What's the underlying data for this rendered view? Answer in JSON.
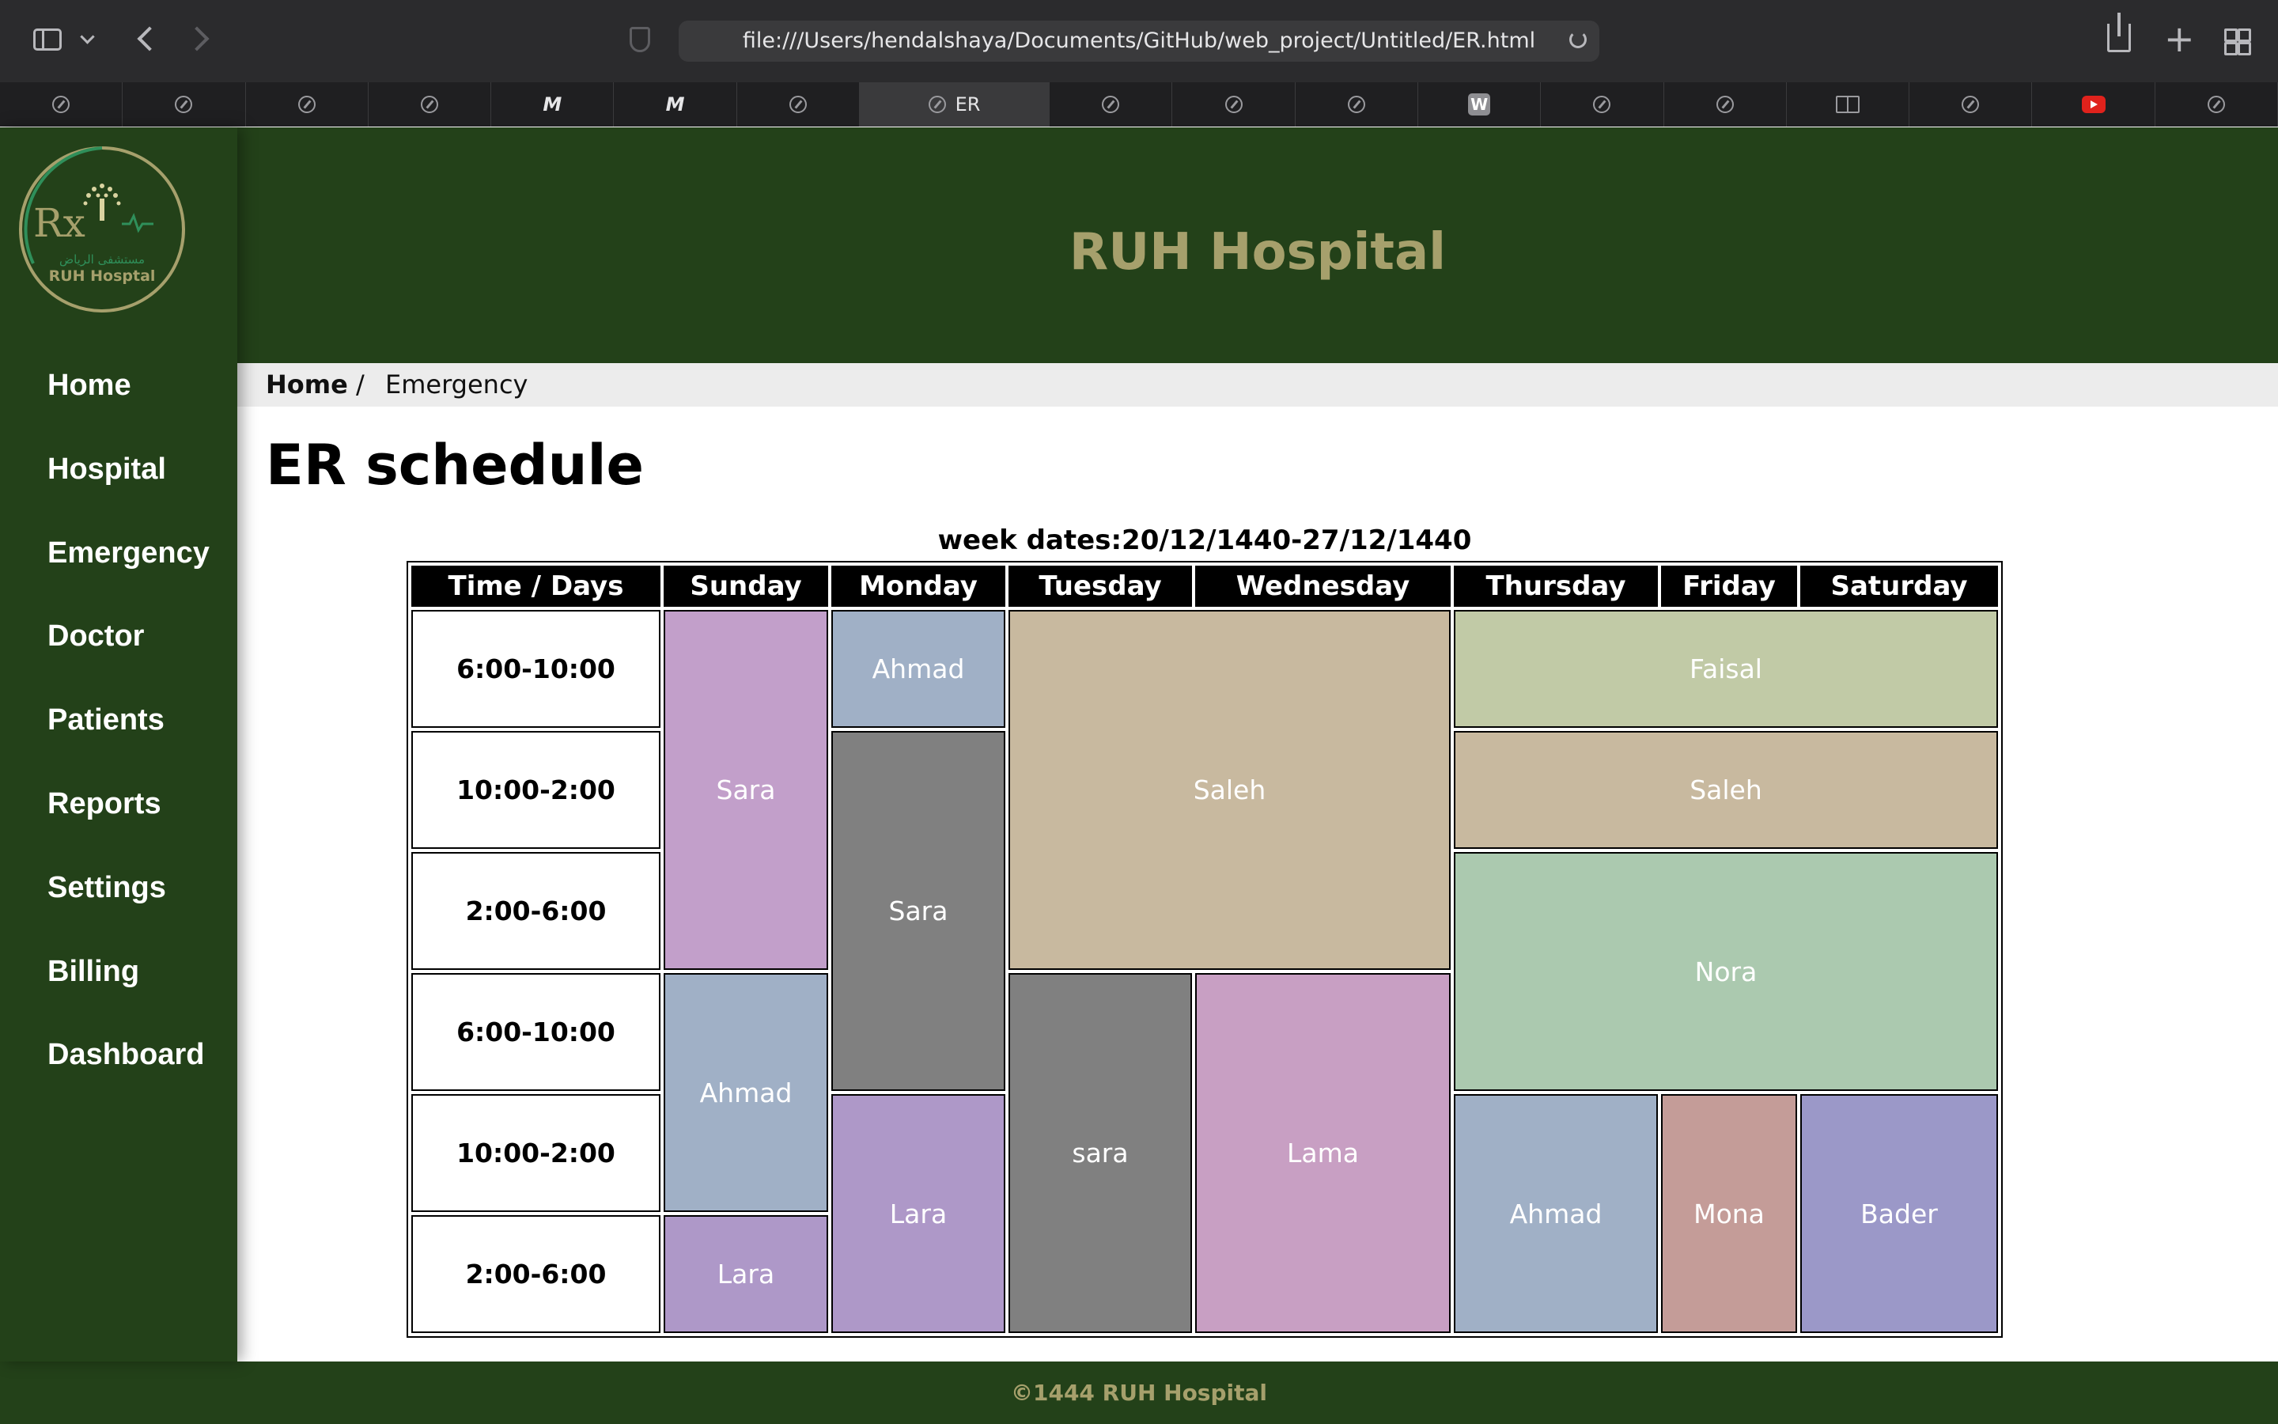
{
  "browser": {
    "url": "file:///Users/hendalshaya/Documents/GitHub/web_project/Untitled/ER.html",
    "active_tab_label": "ER",
    "tabs": [
      "compass-icon",
      "compass-icon",
      "compass-icon",
      "compass-icon",
      "medium-icon",
      "medium-icon",
      "compass-icon",
      "ER",
      "compass-icon",
      "compass-icon",
      "compass-icon",
      "w-icon",
      "compass-icon",
      "compass-icon",
      "book-icon",
      "compass-icon",
      "youtube-icon",
      "compass-icon"
    ],
    "tab_medium_glyph": "M",
    "tab_w_glyph": "W"
  },
  "logo": {
    "brand": "RUH Hosptal",
    "arabic": "مستشفى الرياض",
    "mark": "Rx",
    "colors": {
      "gold": "#a6a06c",
      "green": "#2f8f5a"
    }
  },
  "sidebar": {
    "items": [
      "Home",
      "Hospital",
      "Emergency",
      "Doctor",
      "Patients",
      "Reports",
      "Settings",
      "Billing",
      "Dashboard"
    ]
  },
  "header": {
    "title": "RUH Hospital"
  },
  "breadcrumb": {
    "home": "Home",
    "separator": "/",
    "current": "Emergency"
  },
  "page": {
    "title": "ER schedule",
    "week_dates": "week dates:20/12/1440-27/12/1440"
  },
  "schedule": {
    "headers": [
      "Time / Days",
      "Sunday",
      "Monday",
      "Tuesday",
      "Wednesday",
      "Thursday",
      "Friday",
      "Saturday"
    ],
    "times": [
      "6:00-10:00",
      "10:00-2:00",
      "2:00-6:00",
      "6:00-10:00",
      "10:00-2:00",
      "2:00-6:00"
    ],
    "slots": {
      "sun_1": {
        "name": "Sara",
        "color": "#c29fca"
      },
      "mon_1": {
        "name": "Ahmad",
        "color": "#a0b0c6"
      },
      "tue_wed_1": {
        "name": "Saleh",
        "color": "#c8b99f"
      },
      "thu_sat_1": {
        "name": "Faisal",
        "color": "#c1caa6"
      },
      "mon_2": {
        "name": "Sara",
        "color": "#808080"
      },
      "thu_sat_2": {
        "name": "Saleh",
        "color": "#c8b99f"
      },
      "thu_sat_3": {
        "name": "Nora",
        "color": "#abc9af"
      },
      "sun_4": {
        "name": "Ahmad",
        "color": "#a0b0c6"
      },
      "tue_4": {
        "name": "sara",
        "color": "#808080"
      },
      "wed_4": {
        "name": "Lama",
        "color": "#c89fc3"
      },
      "mon_5": {
        "name": "Lara",
        "color": "#ae98c8"
      },
      "thu_5": {
        "name": "Ahmad",
        "color": "#a0b0c6"
      },
      "fri_5": {
        "name": "Mona",
        "color": "#c49c98"
      },
      "sat_5": {
        "name": "Bader",
        "color": "#9b98c8"
      },
      "sun_6": {
        "name": "Lara",
        "color": "#ae98c8"
      }
    }
  },
  "footer": {
    "text": "©1444 RUH Hospital"
  },
  "colors": {
    "sidebar_green": "#234119",
    "gold_text": "#a6a06c",
    "breadcrumb_bg": "#ececec"
  }
}
